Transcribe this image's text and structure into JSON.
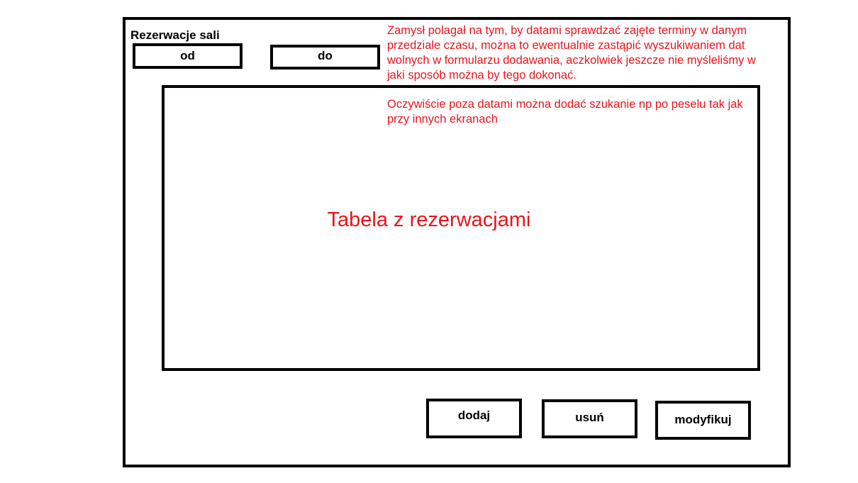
{
  "header": {
    "title": "Rezerwacje sali"
  },
  "date_filter": {
    "from_label": "od",
    "to_label": "do"
  },
  "notes": {
    "date_search_note": "Zamysł polagał na tym, by datami sprawdzać zajęte terminy w danym przedziale czasu, można to ewentualnie zastąpić wyszukiwaniem dat wolnych w formularzu dodawania, aczkolwiek jeszcze nie myśleliśmy w jaki sposób można by tego dokonać.",
    "pesel_search_note": "Oczywiście poza datami można dodać szukanie np po peselu tak jak przy innych ekranach"
  },
  "table": {
    "placeholder": "Tabela z rezerwacjami"
  },
  "actions": {
    "add_label": "dodaj",
    "delete_label": "usuń",
    "modify_label": "modyfikuj"
  },
  "colors": {
    "annotation": "#e8141c",
    "border": "#000000",
    "background": "#ffffff"
  }
}
